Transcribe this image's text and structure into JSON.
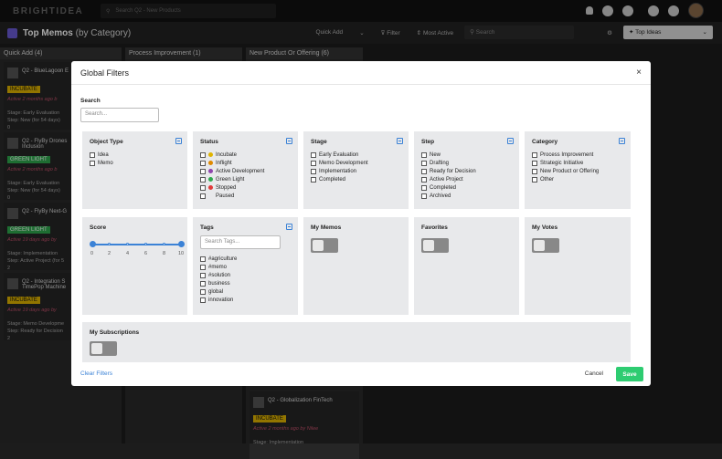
{
  "topbar": {
    "logo": "BRIGHTIDEA",
    "search_placeholder": "Search Q2 - New Products"
  },
  "subbar": {
    "title": "Top Memos",
    "subtitle": "(by Category)",
    "quick_add": "Quick Add",
    "filter": "Filter",
    "most_active": "Most Active",
    "search_placeholder": "Search",
    "top_ideas": "Top Ideas"
  },
  "columns": [
    {
      "title": "Quick Add (4)"
    },
    {
      "title": "Process Improvement (1)"
    },
    {
      "title": "New Product Or Offering (6)"
    }
  ],
  "cards": [
    {
      "title": "Q2 - BlueLagoon E",
      "status": "INCUBATE",
      "activity": "Active 2 months ago b",
      "stage": "Stage:  Early Evaluation",
      "step": "Step:  New  (for 54 days)",
      "count": "0"
    },
    {
      "title": "Q2 - FlyBy Drones Inclusion",
      "status": "GREEN LIGHT",
      "activity": "Active 2 months ago b",
      "stage": "Stage:  Early Evaluation",
      "step": "Step:  New  (for 54 days)",
      "count": "0"
    },
    {
      "title": "Q2 - FlyBy Next-G",
      "status": "GREEN LIGHT",
      "activity": "Active 19 days ago by",
      "stage": "Stage:  Implementation",
      "step": "Step:  Active Project  (for 5",
      "count": "2"
    },
    {
      "title": "Q2 - Integration S TimePop Machine",
      "status": "INCUBATE",
      "activity": "Active 19 days ago by",
      "stage": "Stage:  Memo Developme",
      "step": "Step:  Ready for Decision",
      "count": "2"
    }
  ],
  "bottom_card": {
    "title": "Q2 - Globalization FinTech",
    "status": "INCUBATE",
    "activity": "Active 2 months ago by Nilee",
    "stage": "Stage:  Implementation"
  },
  "modal": {
    "title": "Global Filters",
    "close": "×",
    "search_label": "Search",
    "search_placeholder": "Search...",
    "object_type": {
      "title": "Object Type",
      "options": [
        "Idea",
        "Memo"
      ]
    },
    "status": {
      "title": "Status",
      "options": [
        {
          "label": "Incubate",
          "color": "#e0b400"
        },
        {
          "label": "Inflight",
          "color": "#e08a00"
        },
        {
          "label": "Active Development",
          "color": "#8e44ad"
        },
        {
          "label": "Green Light",
          "color": "#2ea84e"
        },
        {
          "label": "Stopped",
          "color": "#e03a3a"
        },
        {
          "label": "Paused",
          "color": ""
        }
      ]
    },
    "stage": {
      "title": "Stage",
      "options": [
        "Early Evaluation",
        "Memo Development",
        "Implementation",
        "Completed"
      ]
    },
    "step": {
      "title": "Step",
      "options": [
        "New",
        "Drafting",
        "Ready for Decision",
        "Active Project",
        "Completed",
        "Archived"
      ]
    },
    "category": {
      "title": "Category",
      "options": [
        "Process Improvement",
        "Strategic Initiative",
        "New Product or Offering",
        "Other"
      ]
    },
    "score": {
      "title": "Score",
      "ticks": [
        "0",
        "2",
        "4",
        "6",
        "8",
        "10"
      ],
      "min": 0,
      "max": 10
    },
    "tags": {
      "title": "Tags",
      "placeholder": "Search Tags...",
      "options": [
        "#agriculture",
        "#memo",
        "#solution",
        "business",
        "global",
        "innovation"
      ]
    },
    "my_memos": "My Memos",
    "favorites": "Favorites",
    "my_votes": "My Votes",
    "my_subscriptions": "My Subscriptions",
    "clear_filters": "Clear Filters",
    "cancel": "Cancel",
    "save": "Save"
  }
}
